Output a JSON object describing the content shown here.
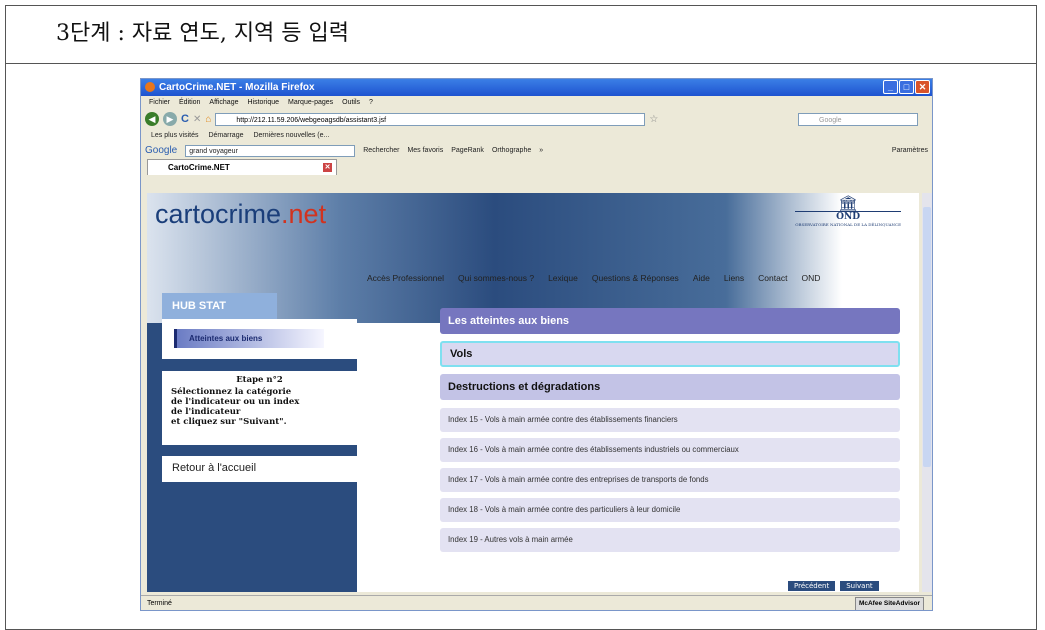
{
  "doc_title": "3단계 : 자료 연도, 지역 등 입력",
  "browser": {
    "window_title": "CartoCrime.NET - Mozilla Firefox",
    "menu": [
      "Fichier",
      "Édition",
      "Affichage",
      "Historique",
      "Marque-pages",
      "Outils",
      "?"
    ],
    "url": "http://212.11.59.206/webgeoagsdb/assistant3.jsf",
    "search_placeholder": "Google",
    "bookmarks": [
      "Les plus visités",
      "Démarrage",
      "Dernières nouvelles (e..."
    ],
    "google_label": "Google",
    "google_query": "grand voyageur",
    "google_items": [
      "Rechercher",
      "Mes favoris",
      "PageRank",
      "Orthographe",
      "»",
      "Paramètres"
    ],
    "tab_label": "CartoCrime.NET",
    "status": "Terminé",
    "mcafee": "McAfee SiteAdvisor"
  },
  "site": {
    "logo_main": "cartocrime",
    "logo_suffix": ".net",
    "ond_name": "OND",
    "ond_sub": "OBSERVATOIRE NATIONAL DE LA DÉLINQUANCE",
    "nav": [
      "Accès Professionnel",
      "Qui sommes-nous ?",
      "Lexique",
      "Questions & Réponses",
      "Aide",
      "Liens",
      "Contact",
      "OND"
    ],
    "hub_title": "HUB STAT",
    "selected_item": "Atteintes aux biens",
    "etape_title": "Etape n°2",
    "etape_lines": [
      "Sélectionnez la catégorie",
      "de l'indicateur ou un index",
      "de l'indicateur",
      "et cliquez sur \"Suivant\"."
    ],
    "retour": "Retour à l'accueil",
    "categories": [
      "Les atteintes aux biens",
      "Vols",
      "Destructions et dégradations"
    ],
    "indexes": [
      "Index 15 - Vols à main armée contre des établissements financiers",
      "Index 16 - Vols à main armée contre des établissements industriels ou commerciaux",
      "Index 17 - Vols à main armée contre des entreprises de transports de fonds",
      "Index 18 - Vols à main armée contre des particuliers à leur domicile",
      "Index 19 - Autres vols à main armée"
    ],
    "btn_prev": "Précédent",
    "btn_next": "Suivant"
  }
}
